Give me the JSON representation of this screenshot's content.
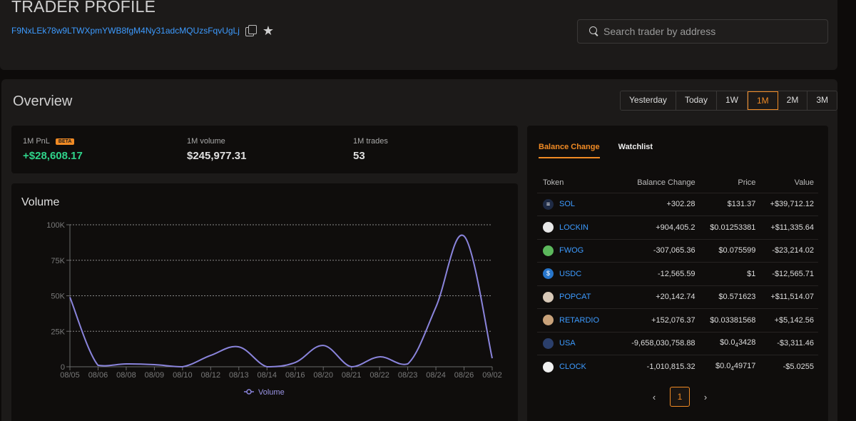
{
  "header": {
    "title": "TRADER PROFILE",
    "address": "F9NxLEk78w9LTWXpmYWB8fgM4Ny31adcMQUzsFqvUgLj",
    "search_placeholder": "Search trader by address"
  },
  "overview": {
    "title": "Overview",
    "ranges": [
      "Yesterday",
      "Today",
      "1W",
      "1M",
      "2M",
      "3M"
    ],
    "active_range": "1M",
    "stats": {
      "pnl_label": "1M PnL",
      "pnl_badge": "BETA",
      "pnl_value": "+$28,608.17",
      "volume_label": "1M volume",
      "volume_value": "$245,977.31",
      "trades_label": "1M trades",
      "trades_value": "53"
    }
  },
  "volume_chart": {
    "title": "Volume"
  },
  "chart_data": {
    "type": "line",
    "title": "Volume",
    "x": [
      "08/05",
      "08/06",
      "08/08",
      "08/09",
      "08/10",
      "08/12",
      "08/13",
      "08/14",
      "08/16",
      "08/20",
      "08/21",
      "08/22",
      "08/23",
      "08/24",
      "08/26",
      "09/02"
    ],
    "series": [
      {
        "name": "Volume",
        "values": [
          49000,
          1000,
          2000,
          1500,
          0,
          8000,
          14000,
          0,
          3000,
          15000,
          0,
          7000,
          2000,
          42000,
          92000,
          6000
        ]
      }
    ],
    "y_ticks": [
      "0",
      "25K",
      "50K",
      "75K",
      "100K"
    ],
    "ylim": [
      0,
      100000
    ],
    "grid": true,
    "legend": "bottom-center",
    "color": "#8a84dc"
  },
  "balance": {
    "tabs": [
      "Balance Change",
      "Watchlist"
    ],
    "active_tab": "Balance Change",
    "columns": [
      "Token",
      "Balance Change",
      "Price",
      "Value"
    ],
    "rows": [
      {
        "token": "SOL",
        "change": "+302.28",
        "price": "$131.37",
        "value": "+$39,712.12",
        "dir": "pos",
        "logo_color": "#1e2a44",
        "logo_glyph": "≡"
      },
      {
        "token": "LOCKIN",
        "change": "+904,405.2",
        "price": "$0.01253381",
        "value": "+$11,335.64",
        "dir": "pos",
        "logo_color": "#e8e8e8",
        "logo_glyph": ""
      },
      {
        "token": "FWOG",
        "change": "-307,065.36",
        "price": "$0.075599",
        "value": "-$23,214.02",
        "dir": "neg",
        "logo_color": "#5cb85c",
        "logo_glyph": ""
      },
      {
        "token": "USDC",
        "change": "-12,565.59",
        "price": "$1",
        "value": "-$12,565.71",
        "dir": "neg",
        "logo_color": "#2775ca",
        "logo_glyph": "$"
      },
      {
        "token": "POPCAT",
        "change": "+20,142.74",
        "price": "$0.571623",
        "value": "+$11,514.07",
        "dir": "pos",
        "logo_color": "#d8c9b8",
        "logo_glyph": ""
      },
      {
        "token": "RETARDIO",
        "change": "+152,076.37",
        "price": "$0.03381568",
        "value": "+$5,142.56",
        "dir": "pos",
        "logo_color": "#c9a27a",
        "logo_glyph": ""
      },
      {
        "token": "USA",
        "change": "-9,658,030,758.88",
        "price_pre": "$0.0",
        "price_sub": "4",
        "price_post": "3428",
        "value": "-$3,311.46",
        "dir": "neg",
        "logo_color": "#2b3f6b",
        "logo_glyph": ""
      },
      {
        "token": "CLOCK",
        "change": "-1,010,815.32",
        "price_pre": "$0.0",
        "price_sub": "4",
        "price_post": "49717",
        "value": "-$5.0255",
        "dir": "neg",
        "logo_color": "#f0f0f0",
        "logo_glyph": ""
      }
    ],
    "pager": {
      "current": "1",
      "prev": "‹",
      "next": "›"
    }
  }
}
